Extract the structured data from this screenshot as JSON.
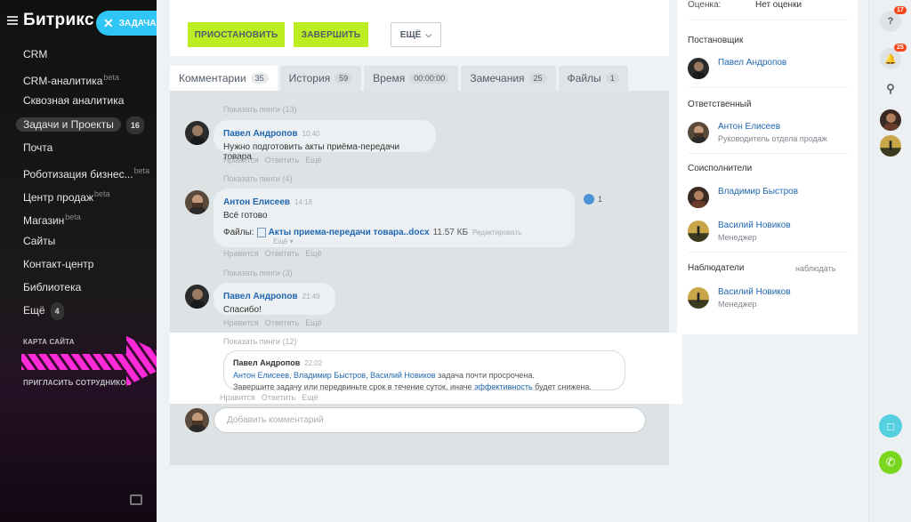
{
  "sidebar": {
    "logo": "Битрикс 24",
    "task_button": "ЗАДАЧА",
    "items": [
      {
        "label": "CRM",
        "sup": "",
        "badge": ""
      },
      {
        "label": "CRM-аналитика",
        "sup": "beta",
        "badge": ""
      },
      {
        "label": "Сквозная аналитика",
        "sup": "",
        "badge": ""
      },
      {
        "label": "Задачи и Проекты",
        "sup": "",
        "badge": "16"
      },
      {
        "label": "Почта",
        "sup": "",
        "badge": ""
      },
      {
        "label": "Роботизация бизнес...",
        "sup": "beta",
        "badge": ""
      },
      {
        "label": "Центр продаж",
        "sup": "beta",
        "badge": ""
      },
      {
        "label": "Магазин",
        "sup": "beta",
        "badge": ""
      },
      {
        "label": "Сайты",
        "sup": "",
        "badge": ""
      },
      {
        "label": "Контакт-центр",
        "sup": "",
        "badge": ""
      },
      {
        "label": "Библиотека",
        "sup": "",
        "badge": ""
      },
      {
        "label": "Ещё",
        "sup": "",
        "badge": "4"
      }
    ],
    "sitemap": "КАРТА САЙТА",
    "invite": "ПРИГЛАСИТЬ СОТРУДНИКОВ"
  },
  "actions": {
    "pause": "ПРИОСТАНОВИТЬ",
    "finish": "ЗАВЕРШИТЬ",
    "more": "ЕЩЁ"
  },
  "tabs": [
    {
      "label": "Комментарии",
      "count": "35"
    },
    {
      "label": "История",
      "count": "59"
    },
    {
      "label": "Время",
      "count": "00:00:00"
    },
    {
      "label": "Замечания",
      "count": "25"
    },
    {
      "label": "Файлы",
      "count": "1"
    }
  ],
  "feed": {
    "comments": [
      {
        "ping": "Показать пинги (13)",
        "author": "Павел Андропов",
        "time": "10:40",
        "text": "Нужно подготовить акты приёма-передачи товара."
      },
      {
        "ping": "Показать пинги (4)",
        "author": "Антон Елисеев",
        "time": "14:18",
        "text": "Всё готово",
        "files_label": "Файлы:",
        "file_name": "Акты приема-передачи товара..docx",
        "file_size": "11.57 КБ",
        "file_edit": "Редактировать",
        "file_more": "Ещё",
        "likes": "1"
      },
      {
        "ping": "Показать пинги (3)",
        "author": "Павел Андропов",
        "time": "21:49",
        "text": "Спасибо!"
      }
    ],
    "action_like": "Нравится",
    "action_reply": "Ответить",
    "action_more": "Ещё",
    "system": {
      "ping": "Показать пинги (12)",
      "author": "Павел Андропов",
      "time": "22:02",
      "mentions": "Антон Елисеев, Владимир Быстров, Василий Новиков",
      "line1_rest": "задача почти просрочена.",
      "line2_start": "Завершите задачу или передвиньте срок в течение суток, иначе",
      "line2_link": "эффективность",
      "line2_end": "будет снижена."
    },
    "comment_placeholder": "Добавить комментарий"
  },
  "right_panel": {
    "rating_label": "Оценка:",
    "rating_value": "Нет оценки",
    "creator_title": "Постановщик",
    "creator_name": "Павел Андропов",
    "responsible_title": "Ответственный",
    "responsible_name": "Антон Елисеев",
    "responsible_role": "Руководитель отдела продаж",
    "co_title": "Соисполнители",
    "co1_name": "Владимир Быстров",
    "co2_name": "Василий Новиков",
    "co2_role": "Менеджер",
    "watchers_title": "Наблюдатели",
    "watch_link": "наблюдать",
    "watcher_name": "Василий Новиков",
    "watcher_role": "Менеджер"
  },
  "right_bar": {
    "help_badge": "17",
    "notify_badge": "25"
  },
  "colors": {
    "accent_green": "#bbed21",
    "link_blue": "#2067b0",
    "task_blue": "#2fc6f6",
    "badge_red": "#f54819"
  }
}
